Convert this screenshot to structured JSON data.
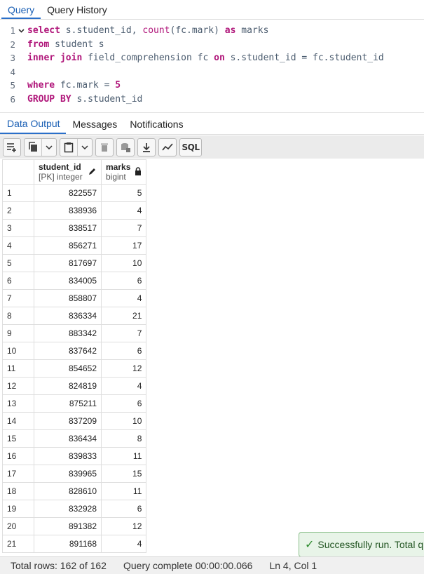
{
  "top_tabs": [
    "Query",
    "Query History"
  ],
  "editor": {
    "lines": [
      {
        "n": "1",
        "fold": true,
        "tokens": [
          {
            "t": "select",
            "c": "kw"
          },
          {
            "t": " s.student_id, ",
            "c": ""
          },
          {
            "t": "count",
            "c": "fn"
          },
          {
            "t": "(fc.mark) ",
            "c": ""
          },
          {
            "t": "as",
            "c": "kw"
          },
          {
            "t": " marks",
            "c": ""
          }
        ]
      },
      {
        "n": "2",
        "fold": false,
        "tokens": [
          {
            "t": "from",
            "c": "kw"
          },
          {
            "t": " student s",
            "c": ""
          }
        ]
      },
      {
        "n": "3",
        "fold": false,
        "tokens": [
          {
            "t": "inner join",
            "c": "kw"
          },
          {
            "t": " field_comprehension fc ",
            "c": ""
          },
          {
            "t": "on",
            "c": "kw"
          },
          {
            "t": " s.student_id = fc.student_id",
            "c": ""
          }
        ]
      },
      {
        "n": "4",
        "fold": false,
        "tokens": []
      },
      {
        "n": "5",
        "fold": false,
        "tokens": [
          {
            "t": "where",
            "c": "kw"
          },
          {
            "t": " fc.mark = ",
            "c": ""
          },
          {
            "t": "5",
            "c": "num"
          }
        ]
      },
      {
        "n": "6",
        "fold": false,
        "tokens": [
          {
            "t": "GROUP BY",
            "c": "kw"
          },
          {
            "t": " s.student_id",
            "c": ""
          }
        ]
      }
    ]
  },
  "result_tabs": [
    "Data Output",
    "Messages",
    "Notifications"
  ],
  "toolbar": {
    "sql_label": "SQL"
  },
  "grid": {
    "columns": [
      {
        "name": "student_id",
        "type": "[PK] integer",
        "icon": "pencil-icon"
      },
      {
        "name": "marks",
        "type": "bigint",
        "icon": "lock-icon"
      }
    ],
    "rows": [
      [
        "1",
        "822557",
        "5"
      ],
      [
        "2",
        "838936",
        "4"
      ],
      [
        "3",
        "838517",
        "7"
      ],
      [
        "4",
        "856271",
        "17"
      ],
      [
        "5",
        "817697",
        "10"
      ],
      [
        "6",
        "834005",
        "6"
      ],
      [
        "7",
        "858807",
        "4"
      ],
      [
        "8",
        "836334",
        "21"
      ],
      [
        "9",
        "883342",
        "7"
      ],
      [
        "10",
        "837642",
        "6"
      ],
      [
        "11",
        "854652",
        "12"
      ],
      [
        "12",
        "824819",
        "4"
      ],
      [
        "13",
        "875211",
        "6"
      ],
      [
        "14",
        "837209",
        "10"
      ],
      [
        "15",
        "836434",
        "8"
      ],
      [
        "16",
        "839833",
        "11"
      ],
      [
        "17",
        "839965",
        "15"
      ],
      [
        "18",
        "828610",
        "11"
      ],
      [
        "19",
        "832928",
        "6"
      ],
      [
        "20",
        "891382",
        "12"
      ],
      [
        "21",
        "891168",
        "4"
      ]
    ]
  },
  "toast": {
    "text": "Successfully run. Total q"
  },
  "status": {
    "total_rows": "Total rows: 162 of 162",
    "query_time": "Query complete 00:00:00.066",
    "cursor": "Ln 4, Col 1"
  },
  "colors": {
    "accent": "#1a5fb4",
    "keyword": "#b0167a",
    "success_bg": "#e8f4e8"
  }
}
